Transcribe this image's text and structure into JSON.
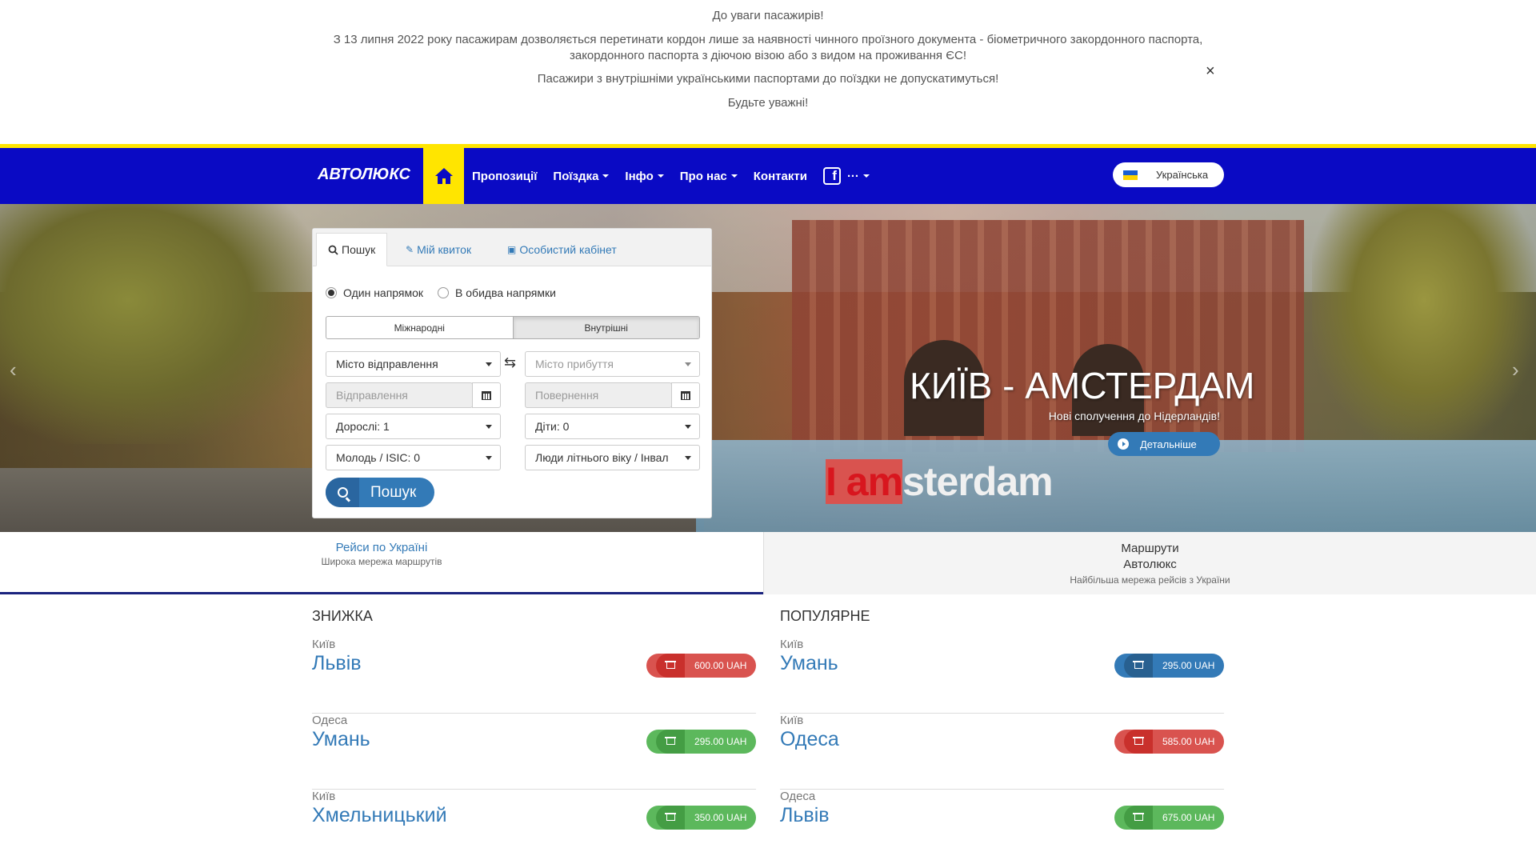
{
  "notice": {
    "line1": "До уваги пасажирів!",
    "line2": "З 13 липня 2022 року пасажирам дозволяється перетинати кордон лише за наявності чинного проїзного документа - біометричного закордонного паспорта, закордонного паспорта з діючою  візою або з видом на проживання ЄС!",
    "line3": "Пасажири з внутрішніми українськими паспортами до поїздки не допускатимуться!",
    "line4": "Будьте уважні!",
    "close": "×"
  },
  "nav": {
    "logo": "АВТОЛЮКС",
    "items": [
      "Пропозиції",
      "Поїздка",
      "Інфо",
      "Про нас",
      "Контакти"
    ],
    "more": "···",
    "facebook": "f",
    "language": "Українська"
  },
  "hero": {
    "title": "КИЇВ - АМСТЕРДАМ",
    "subtitle": "Нові сполучення до Нідерландів!",
    "button": "Детальніше",
    "sign_red": "I am",
    "sign_white": "sterdam",
    "prev": "‹",
    "next": "›"
  },
  "search": {
    "tabs": [
      "Пошук",
      "Мій квиток",
      "Особистий кабінет"
    ],
    "radio_one_way": "Один напрямок",
    "radio_round": "В обидва напрямки",
    "seg_international": "Міжнародні",
    "seg_domestic": "Внутрішні",
    "from_city": "Місто відправлення",
    "to_city": "Місто прибуття",
    "departure": "Відправлення",
    "return": "Повернення",
    "adults": "Дорослі: 1",
    "children": "Діти: 0",
    "youth": "Молодь / ISIC: 0",
    "seniors": "Люди літнього віку / Інвал",
    "button": "Пошук"
  },
  "subtabs": {
    "ukraine_title": "Рейси по Україні",
    "ukraine_sub": "Широка мережа маршрутів",
    "routes_title_1": "Маршрути",
    "routes_title_2": "Автолюкс",
    "routes_sub": "Найбільша мережа рейсів з України"
  },
  "discount": {
    "heading": "ЗНИЖКА",
    "routes": [
      {
        "from": "Київ",
        "to": "Львів",
        "price": "600.00 UAH",
        "color": "red"
      },
      {
        "from": "Одеса",
        "to": "Умань",
        "price": "295.00 UAH",
        "color": "green"
      },
      {
        "from": "Київ",
        "to": "Хмельницький",
        "price": "350.00 UAH",
        "color": "green"
      }
    ]
  },
  "popular": {
    "heading": "ПОПУЛЯРНЕ",
    "routes": [
      {
        "from": "Київ",
        "to": "Умань",
        "price": "295.00 UAH",
        "color": "blue"
      },
      {
        "from": "Київ",
        "to": "Одеса",
        "price": "585.00 UAH",
        "color": "red"
      },
      {
        "from": "Одеса",
        "to": "Львів",
        "price": "675.00 UAH",
        "color": "green"
      }
    ]
  },
  "colors": {
    "nav_bg": "#0a0ac4",
    "accent_yellow": "#ffe500",
    "link": "#337ab7",
    "red": "#d9534f",
    "green": "#5cb85c"
  }
}
